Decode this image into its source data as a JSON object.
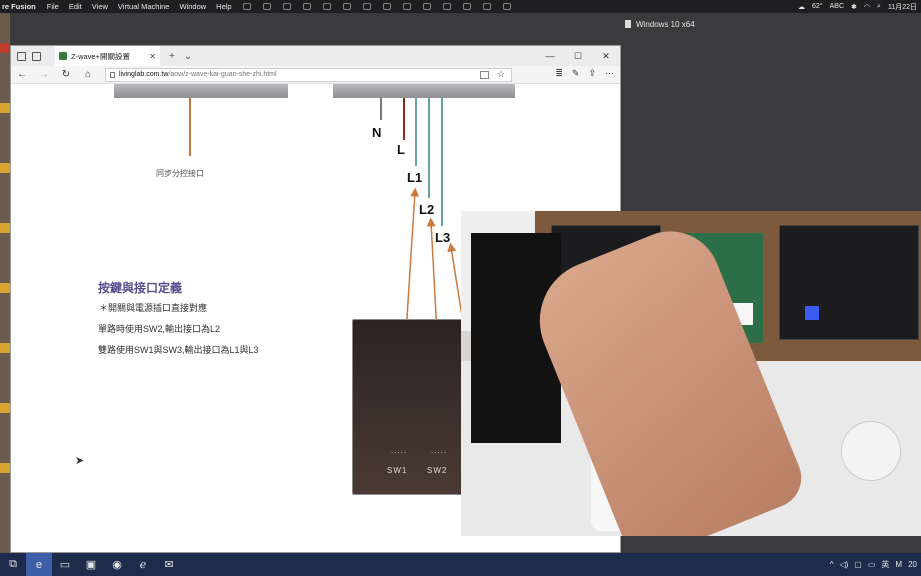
{
  "mac_menu": {
    "app_name": "re Fusion",
    "items": [
      "File",
      "Edit",
      "View",
      "Virtual Machine",
      "Window",
      "Help"
    ],
    "temperature": "62°",
    "input_source": "ABC",
    "date": "11月22日"
  },
  "vm": {
    "title": "Windows 10 x64"
  },
  "browser": {
    "tab_title": "Z-wave+開關設置",
    "url_host": "livinglab.com.tw",
    "url_path": "/aow/z-wave-kai-guan-she-zhi.html"
  },
  "page": {
    "terminals": [
      "N",
      "L",
      "L1",
      "L2",
      "L3"
    ],
    "sync_caption": "同步分控接口",
    "heading": "按鍵與接口定義",
    "notes": [
      "＊開關與電源插口直接對應",
      "單路時使用SW2,輸出接口為L2",
      "雙路使用SW1與SW3,輸出接口為L1與L3"
    ],
    "switch_labels": [
      "SW1",
      "SW2"
    ],
    "switch_dots": "....."
  },
  "taskbar": {
    "ime": "英",
    "ime_mode": "M",
    "clock_fragment": "20"
  },
  "colors": {
    "wire_orange": "#c97a3f",
    "wire_teal": "#6aa3a5",
    "wire_red": "#8b2b1d",
    "heading_purple": "#5a4d8e",
    "taskbar": "#1e2b4a"
  }
}
